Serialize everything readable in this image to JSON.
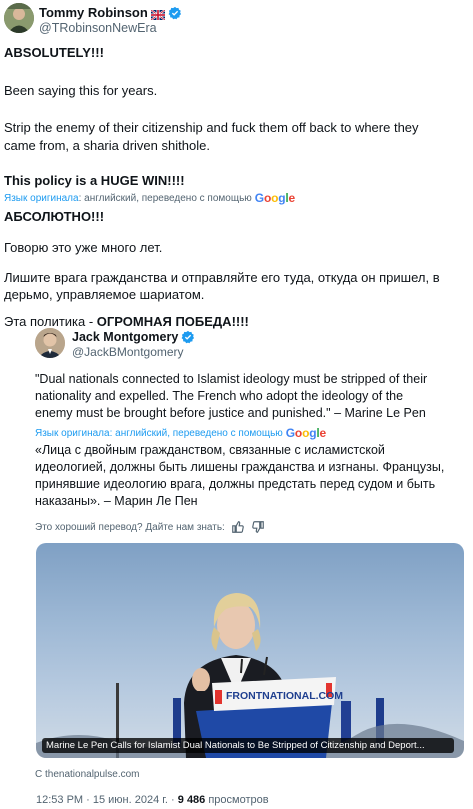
{
  "author": {
    "name": "Tommy Robinson",
    "handle": "@TRobinsonNewEra"
  },
  "tweet": {
    "line1": "ABSOLUTELY!!!",
    "line2": "Been saying this for years.",
    "line3a": "Strip the enemy of their citizenship and fuck them off back to where they",
    "line3b": "came from, a sharia driven shithole.",
    "line4": "This policy is a HUGE WIN!!!!"
  },
  "translation": {
    "lang_label": "Язык оригинала",
    "lang_rest": ": английский, переведено с помощью",
    "google": "Google",
    "line1": "АБСОЛЮТНО!!!",
    "line2": "Говорю это уже много лет.",
    "line3a": "Лишите врага гражданства и отправляйте его туда, откуда он пришел, в",
    "line3b": "дерьмо, управляемое шариатом.",
    "line4_regular": "Эта политика - ",
    "line4_bold": "ОГРОМНАЯ ПОБЕДА!!!!"
  },
  "quote": {
    "name": "Jack Montgomery",
    "handle": "@JackBMontgomery",
    "text1": "\"Dual nationals connected to Islamist ideology must be stripped of their",
    "text2": "nationality and expelled. The French who adopt the ideology of the",
    "text3": "enemy must be brought before justice and punished.\" – Marine Le Pen",
    "translate_label": "Язык оригинала: английский, переведено с помощью",
    "google": "Google",
    "tr1": "«Лица с двойным гражданством, связанные с исламистской",
    "tr2": "идеологией, должны быть лишены гражданства и изгнаны. Французы,",
    "tr3": "принявшие идеологию врага, должны предстать перед судом и быть",
    "tr4": "наказаны». – Марин Ле Пен",
    "feedback": "Это хороший перевод? Дайте нам знать:",
    "media_caption": "Marine Le Pen Calls for Islamist Dual Nationals to Be Stripped of Citizenship and Deport...",
    "podium_text": "FRONTNATIONAL.COM",
    "source": "С thenationalpulse.com"
  },
  "meta": {
    "time": "12:53 PM · 15 июн. 2024 г. · ",
    "views": "9 486",
    "views_label": " просмотров"
  },
  "colors": {
    "link": "#1d9bf0",
    "secondary": "#536471",
    "text": "#0f1419"
  }
}
